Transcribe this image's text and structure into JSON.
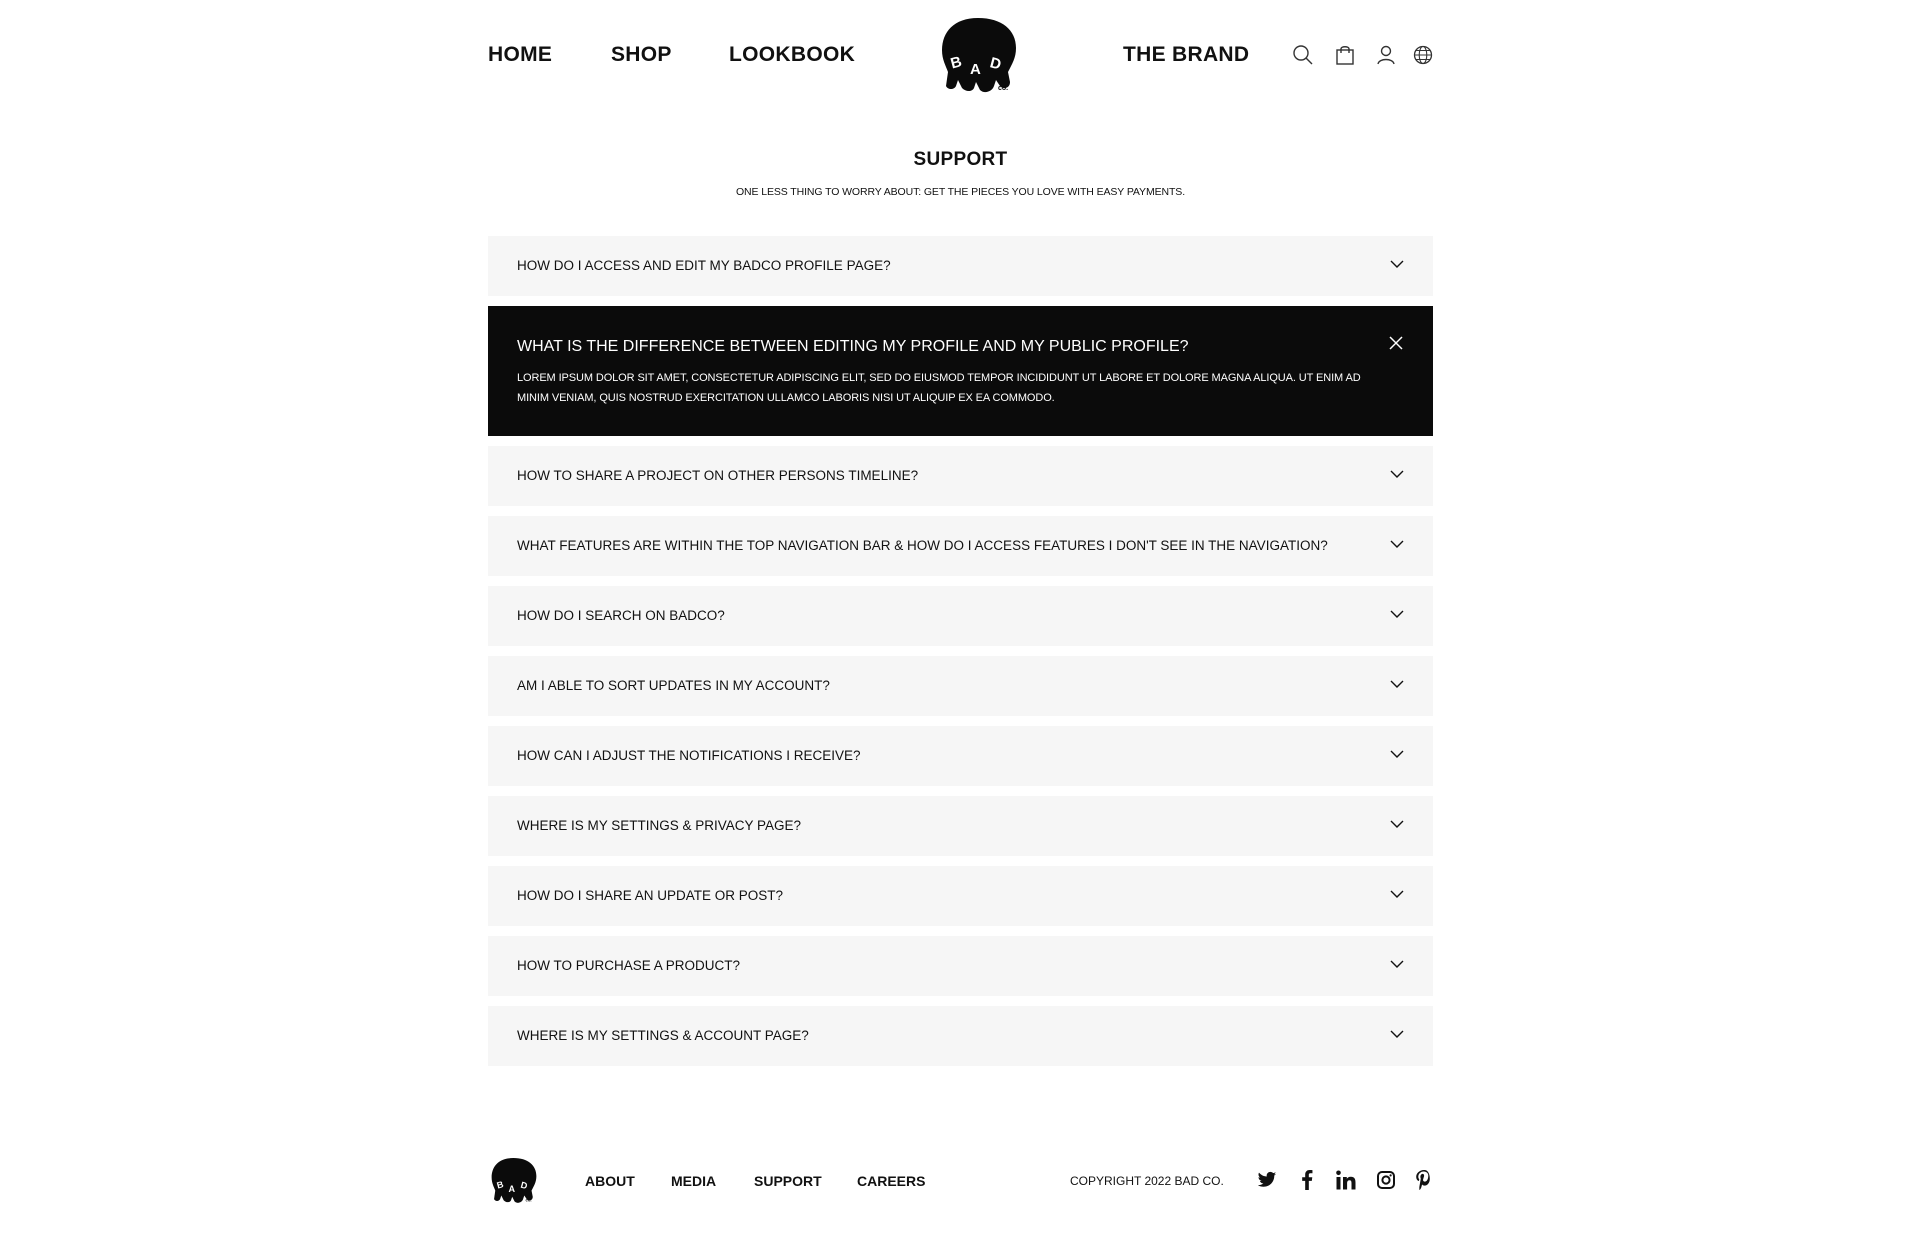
{
  "nav": {
    "home": "HOME",
    "shop": "SHOP",
    "lookbook": "LOOKBOOK",
    "brand": "THE BRAND"
  },
  "logo": {
    "lettering": "BAD CO."
  },
  "header_icons": [
    "search-icon",
    "bag-icon",
    "user-icon",
    "globe-icon"
  ],
  "page": {
    "title": "SUPPORT",
    "subtitle": "ONE LESS THING TO WORRY ABOUT: GET THE PIECES YOU LOVE WITH EASY PAYMENTS."
  },
  "faq": {
    "items": [
      {
        "question": "HOW DO I ACCESS AND EDIT MY BADCO PROFILE PAGE?"
      },
      {
        "question": "WHAT IS THE DIFFERENCE BETWEEN EDITING MY PROFILE AND MY PUBLIC PROFILE?",
        "answer": "LOREM IPSUM DOLOR SIT AMET, CONSECTETUR ADIPISCING ELIT, SED DO EIUSMOD TEMPOR INCIDIDUNT UT LABORE ET DOLORE MAGNA ALIQUA. UT ENIM AD MINIM VENIAM, QUIS NOSTRUD EXERCITATION ULLAMCO LABORIS NISI UT ALIQUIP EX EA COMMODO.",
        "expanded": true
      },
      {
        "question": "HOW TO SHARE A PROJECT ON OTHER PERSONS TIMELINE?"
      },
      {
        "question": "WHAT FEATURES ARE WITHIN THE TOP NAVIGATION BAR & HOW DO I ACCESS FEATURES I DON'T SEE IN THE NAVIGATION?"
      },
      {
        "question": "HOW DO I SEARCH ON BADCO?"
      },
      {
        "question": "AM I ABLE TO SORT UPDATES IN MY ACCOUNT?"
      },
      {
        "question": "HOW CAN I ADJUST THE NOTIFICATIONS I RECEIVE?"
      },
      {
        "question": "WHERE IS MY SETTINGS & PRIVACY PAGE?"
      },
      {
        "question": "HOW DO I SHARE AN UPDATE OR POST?"
      },
      {
        "question": "HOW TO PURCHASE A PRODUCT?"
      },
      {
        "question": "WHERE IS MY SETTINGS & ACCOUNT PAGE?"
      }
    ]
  },
  "footer": {
    "links": {
      "about": "ABOUT",
      "media": "MEDIA",
      "support": "SUPPORT",
      "careers": "CAREERS"
    },
    "copyright": "COPYRIGHT 2022 BAD CO.",
    "social": [
      "twitter-icon",
      "facebook-icon",
      "linkedin-icon",
      "instagram-icon",
      "pinterest-icon"
    ]
  },
  "colors": {
    "accent": "#0b0b0b",
    "item_bg": "#f6f6f6",
    "text": "#111111"
  }
}
